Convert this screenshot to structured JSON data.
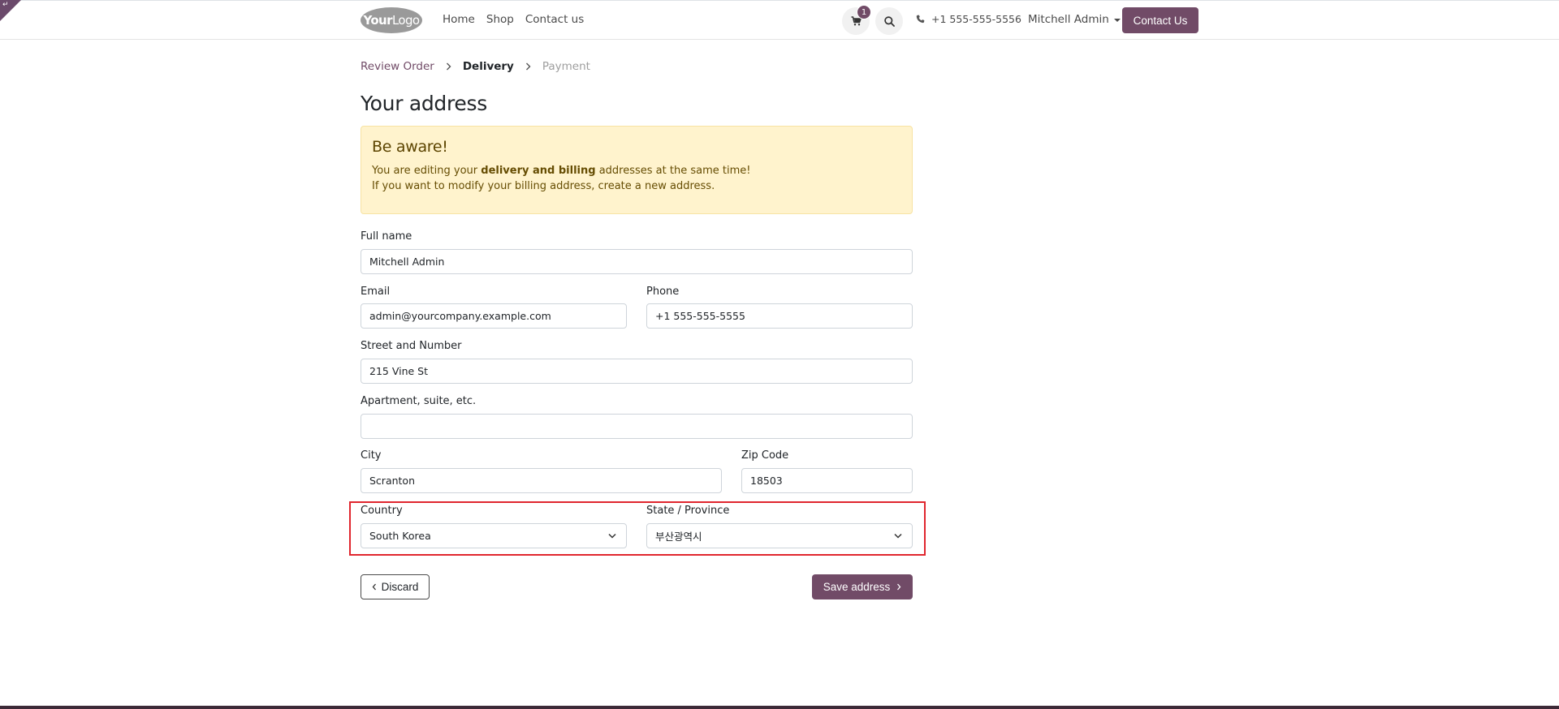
{
  "header": {
    "logo_bold": "Your",
    "logo_light": "Logo",
    "nav": [
      "Home",
      "Shop",
      "Contact us"
    ],
    "cart_count": "1",
    "phone": "+1 555-555-5556",
    "user": "Mitchell Admin",
    "contact_button": "Contact Us"
  },
  "breadcrumb": {
    "step1": "Review Order",
    "step2": "Delivery",
    "step3": "Payment"
  },
  "page_title": "Your address",
  "alert": {
    "title": "Be aware!",
    "line1_pre": "You are editing your ",
    "line1_bold": "delivery and billing",
    "line1_post": " addresses at the same time!",
    "line2": "If you want to modify your billing address, create a new address."
  },
  "form": {
    "full_name_label": "Full name",
    "full_name_value": "Mitchell Admin",
    "email_label": "Email",
    "email_value": "admin@yourcompany.example.com",
    "phone_label": "Phone",
    "phone_value": "+1 555-555-5555",
    "street_label": "Street and Number",
    "street_value": "215 Vine St",
    "apartment_label": "Apartment, suite, etc.",
    "apartment_value": "",
    "city_label": "City",
    "city_value": "Scranton",
    "zip_label": "Zip Code",
    "zip_value": "18503",
    "country_label": "Country",
    "country_value": "South Korea",
    "state_label": "State / Province",
    "state_value": "부산광역시"
  },
  "buttons": {
    "discard": "Discard",
    "save": "Save address"
  },
  "colors": {
    "brand": "#714b67",
    "alert_bg": "#fff3cd",
    "highlight": "#e0262e"
  }
}
